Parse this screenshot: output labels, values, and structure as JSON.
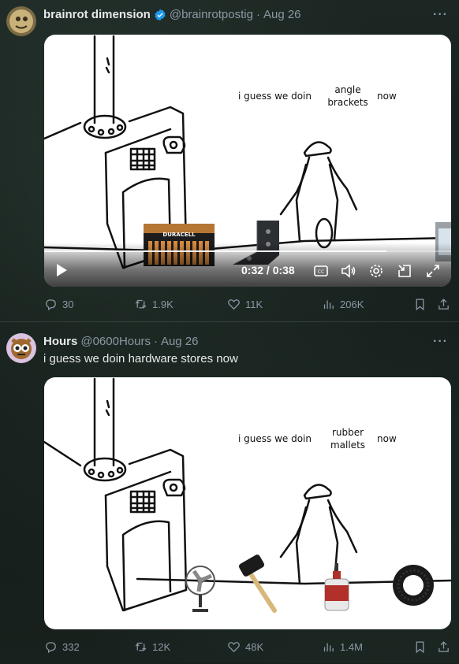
{
  "tweets": [
    {
      "display_name": "brainrot dimension",
      "handle": "@brainrotpostig",
      "separator": "·",
      "date": "Aug 26",
      "text": "",
      "meme": {
        "label_left": "i guess we doin",
        "label_middle": "angle brackets",
        "label_right": "now",
        "product_battery_brand": "DURACELL",
        "product_battery_sub": "POWER BOOST"
      },
      "video": {
        "time": "0:32 / 0:38",
        "progress_fraction": 0.842
      },
      "stats": {
        "replies": "30",
        "reposts": "1.9K",
        "likes": "11K",
        "views": "206K"
      }
    },
    {
      "display_name": "Hours",
      "handle": "@0600Hours",
      "separator": "·",
      "date": "Aug 26",
      "text": "i guess we doin hardware stores now",
      "meme": {
        "label_left": "i guess we doin",
        "label_middle": "rubber mallets",
        "label_right": "now"
      },
      "stats": {
        "replies": "332",
        "reposts": "12K",
        "likes": "48K",
        "views": "1.4M"
      }
    }
  ],
  "icons": {
    "more": "more-icon",
    "verified": "verified-badge-icon",
    "reply": "reply-icon",
    "repost": "repost-icon",
    "like": "like-icon",
    "views": "views-icon",
    "bookmark": "bookmark-icon",
    "share": "share-icon"
  },
  "colors": {
    "verified": "#1d9bf0",
    "muted": "#8b98a5",
    "text": "#e7e9ea"
  }
}
